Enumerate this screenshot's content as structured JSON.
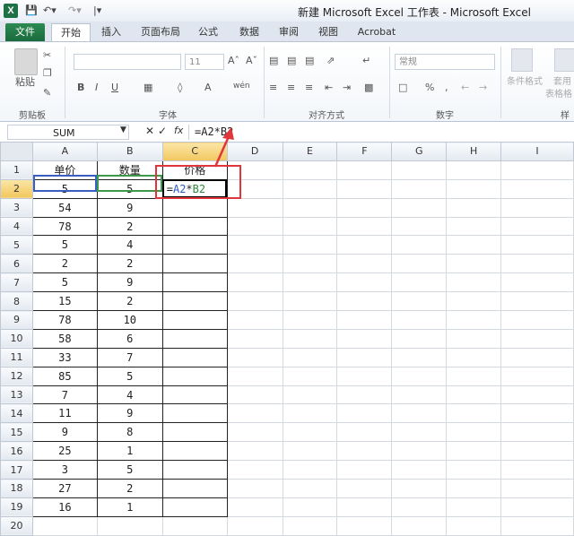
{
  "window": {
    "title": "新建 Microsoft Excel 工作表 - Microsoft Excel",
    "app_icon": "X"
  },
  "tabs": [
    "文件",
    "开始",
    "插入",
    "页面布局",
    "公式",
    "数据",
    "审阅",
    "视图",
    "Acrobat"
  ],
  "ribbon": {
    "paste_label": "粘贴",
    "font_name": "",
    "font_size": "11",
    "number_format": "常规",
    "percent_symbol": "%",
    "comma_symbol": ",",
    "bold": "B",
    "italic": "I",
    "underline": "U",
    "font_color": "A",
    "phonetic": "wén",
    "conditional_format": "条件格式",
    "table_format_line1": "套用",
    "table_format_line2": "表格格",
    "groups": [
      "剪贴板",
      "字体",
      "对齐方式",
      "数字",
      "样"
    ]
  },
  "formula_bar": {
    "name_box": "SUM",
    "cancel": "✕",
    "enter": "✓",
    "fx": "fx",
    "content": "=A2*B2"
  },
  "sheet": {
    "columns": [
      "A",
      "B",
      "C",
      "D",
      "E",
      "F",
      "G",
      "H",
      "I"
    ],
    "rows": [
      "1",
      "2",
      "3",
      "4",
      "5",
      "6",
      "7",
      "8",
      "9",
      "10",
      "11",
      "12",
      "13",
      "14",
      "15",
      "16",
      "17",
      "18",
      "19",
      "20"
    ],
    "header": {
      "a": "单价",
      "b": "数量",
      "c": "价格"
    },
    "formula_ref_a": "A2",
    "formula_op": "*",
    "formula_ref_b": "B2",
    "formula_eq": "=",
    "data": [
      {
        "a": "5",
        "b": "5"
      },
      {
        "a": "54",
        "b": "9"
      },
      {
        "a": "78",
        "b": "2"
      },
      {
        "a": "5",
        "b": "4"
      },
      {
        "a": "2",
        "b": "2"
      },
      {
        "a": "5",
        "b": "9"
      },
      {
        "a": "15",
        "b": "2"
      },
      {
        "a": "78",
        "b": "10"
      },
      {
        "a": "58",
        "b": "6"
      },
      {
        "a": "33",
        "b": "7"
      },
      {
        "a": "85",
        "b": "5"
      },
      {
        "a": "7",
        "b": "4"
      },
      {
        "a": "11",
        "b": "9"
      },
      {
        "a": "9",
        "b": "8"
      },
      {
        "a": "25",
        "b": "1"
      },
      {
        "a": "3",
        "b": "5"
      },
      {
        "a": "27",
        "b": "2"
      },
      {
        "a": "16",
        "b": "1"
      }
    ]
  },
  "colors": {
    "excel_green": "#1e7145",
    "highlight": "#e0353a",
    "ref_a": "#2e59c9",
    "ref_b": "#2b8a3a"
  }
}
